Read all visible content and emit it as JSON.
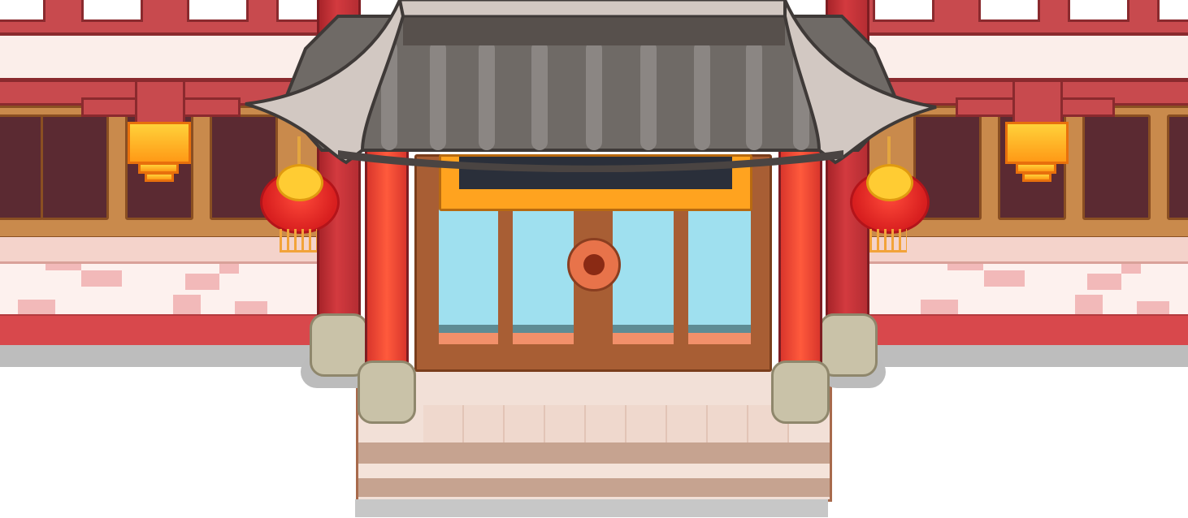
{
  "scene": {
    "name": "temple-gate-storefront",
    "signboard": {
      "text": "",
      "color": "#ffa31f",
      "panel_color": "#2a2f3a"
    },
    "colors": {
      "roof_tile": "#6f6a66",
      "roof_trim": "#d2c8c2",
      "pillar_red": "#ff5a3c",
      "wall_red": "#d8484c",
      "door_wood": "#a85e34",
      "glass": "#9fe0ef",
      "lantern_red": "#d81f1f",
      "lantern_gold": "#ffcc33"
    },
    "icons": {
      "door_handle": "doorknob-icon",
      "lanterns": "lantern-icon",
      "wall_lamps": "lamp-icon"
    }
  }
}
